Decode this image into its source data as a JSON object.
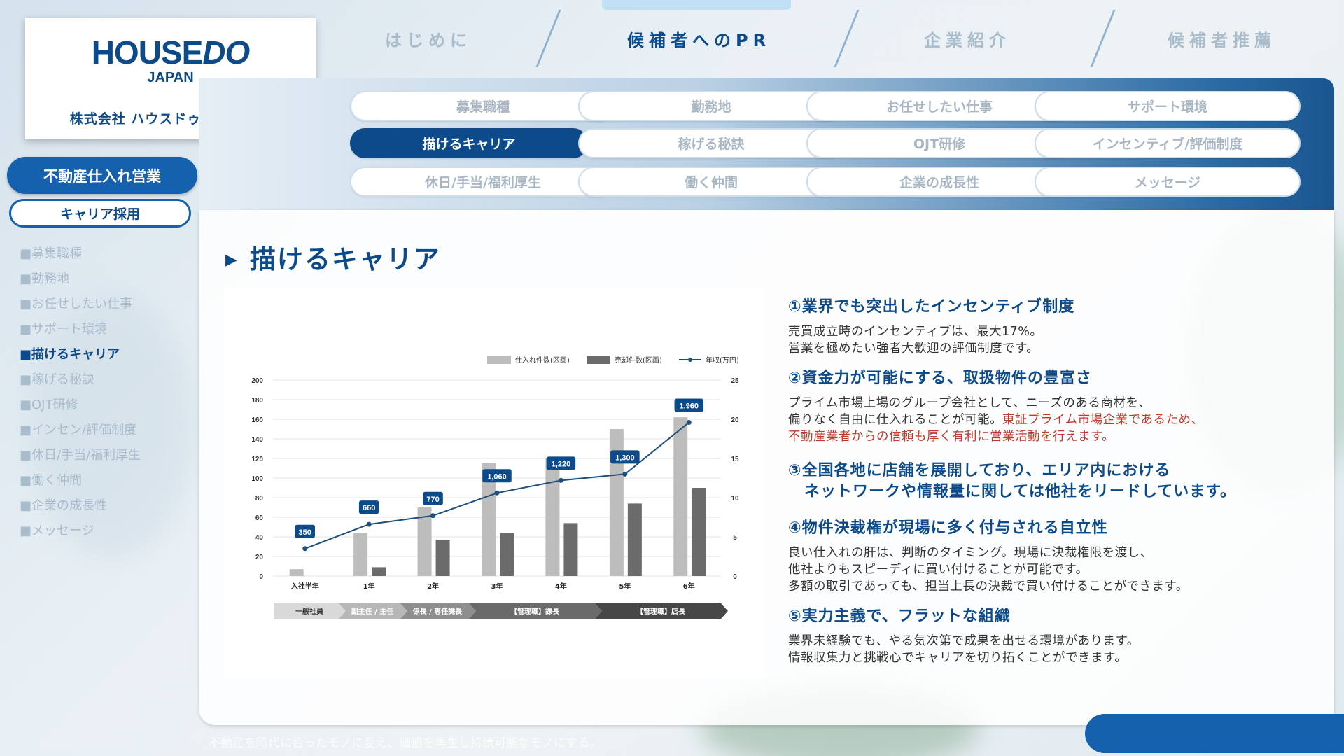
{
  "brand": {
    "logo_main": "HOUSE",
    "logo_do": "DO",
    "logo_sub": "JAPAN",
    "company": "株式会社 ハウスドゥ・ジャパン"
  },
  "top_tabs": [
    "はじめに",
    "候補者へのPR",
    "企業紹介",
    "候補者推薦"
  ],
  "top_tab_active": 1,
  "sub_tabs": [
    [
      "募集職種",
      "勤務地",
      "お任せしたい仕事",
      "サポート環境"
    ],
    [
      "描けるキャリア",
      "稼げる秘訣",
      "OJT研修",
      "インセンティブ/評価制度"
    ],
    [
      "休日/手当/福利厚生",
      "働く仲間",
      "企業の成長性",
      "メッセージ"
    ]
  ],
  "side": {
    "primary": "不動産仕入れ営業",
    "secondary": "キャリア採用",
    "items": [
      "■募集職種",
      "■勤務地",
      "■お任せしたい仕事",
      "■サポート環境",
      "■描けるキャリア",
      "■稼げる秘訣",
      "■OJT研修",
      "■インセン/評価制度",
      "■休日/手当/福利厚生",
      "■働く仲間",
      "■企業の成長性",
      "■メッセージ"
    ],
    "active_index": 4
  },
  "main": {
    "title": "描けるキャリア",
    "title_marker": "▶",
    "points": [
      {
        "heading": "①業界でも突出したインセンティブ制度",
        "lines": [
          "売買成立時のインセンティブは、最大17%。",
          "営業を極めたい強者大歓迎の評価制度です。"
        ]
      },
      {
        "heading": "②資金力が可能にする、取扱物件の豊富さ",
        "lines": [
          "プライム市場上場のグループ会社として、ニーズのある商材を、"
        ],
        "line2_plain": "偏りなく自由に仕入れることが可能。",
        "line2_red": "東証プライム市場企業であるため、",
        "line3_red": "不動産業者からの信頼も厚く有利に営業活動を行えます。"
      },
      {
        "heading": "③全国各地に店舗を展開しており、エリア内における",
        "heading2": "　ネットワークや情報量に関しては他社をリードしています。",
        "lines": []
      },
      {
        "heading": "④物件決裁権が現場に多く付与される自立性",
        "lines": [
          "良い仕入れの肝は、判断のタイミング。現場に決裁権限を渡し、",
          "他社よりもスピーディに買い付けることが可能です。",
          "多額の取引であっても、担当上長の決裁で買い付けることができます。"
        ]
      },
      {
        "heading": "⑤実力主義で、フラットな組織",
        "lines": [
          "業界未経験でも、やる気次第で成果を出せる環境があります。",
          "情報収集力と挑戦心でキャリアを切り拓くことができます。"
        ]
      }
    ]
  },
  "footer": {
    "text": "不動産を時代に合ったモノに変え、価値を再生し持続可能なモノにする。"
  },
  "colors": {
    "brand_blue": "#0d4a8a",
    "accent_blue": "#1561ad",
    "bar_light": "#bdbdbd",
    "bar_dark": "#6b6b6b",
    "line": "#1f4e79"
  },
  "chart_data": {
    "type": "bar",
    "categories": [
      "入社半年",
      "1年",
      "2年",
      "3年",
      "4年",
      "5年",
      "6年"
    ],
    "series": [
      {
        "name": "仕入れ件数(区画)",
        "type": "bar",
        "axis": "left",
        "values": [
          7,
          44,
          70,
          115,
          120,
          150,
          162
        ]
      },
      {
        "name": "売却件数(区画)",
        "type": "bar",
        "axis": "left",
        "values": [
          0,
          9,
          37,
          44,
          54,
          74,
          90
        ]
      },
      {
        "name": "年収(万円)",
        "type": "line",
        "axis": "right",
        "values": [
          350,
          660,
          770,
          1060,
          1220,
          1300,
          1960
        ],
        "labels": [
          "350",
          "660",
          "770",
          "1,060",
          "1,220",
          "1,300",
          "1,960"
        ]
      }
    ],
    "ylim": [
      0,
      200
    ],
    "yticks": [
      0,
      20,
      40,
      60,
      80,
      100,
      120,
      140,
      160,
      180,
      200
    ],
    "y2lim": [
      0,
      25
    ],
    "y2ticks": [
      0,
      5,
      10,
      15,
      20,
      25
    ],
    "y2_line_scale": [
      0,
      2500
    ],
    "legend_position": "top-right",
    "grid": true,
    "career_stages": [
      "一般社員",
      "副主任 / 主任",
      "係長 / 専任課長",
      "【管理職】課長",
      "【管理職】店長"
    ]
  }
}
